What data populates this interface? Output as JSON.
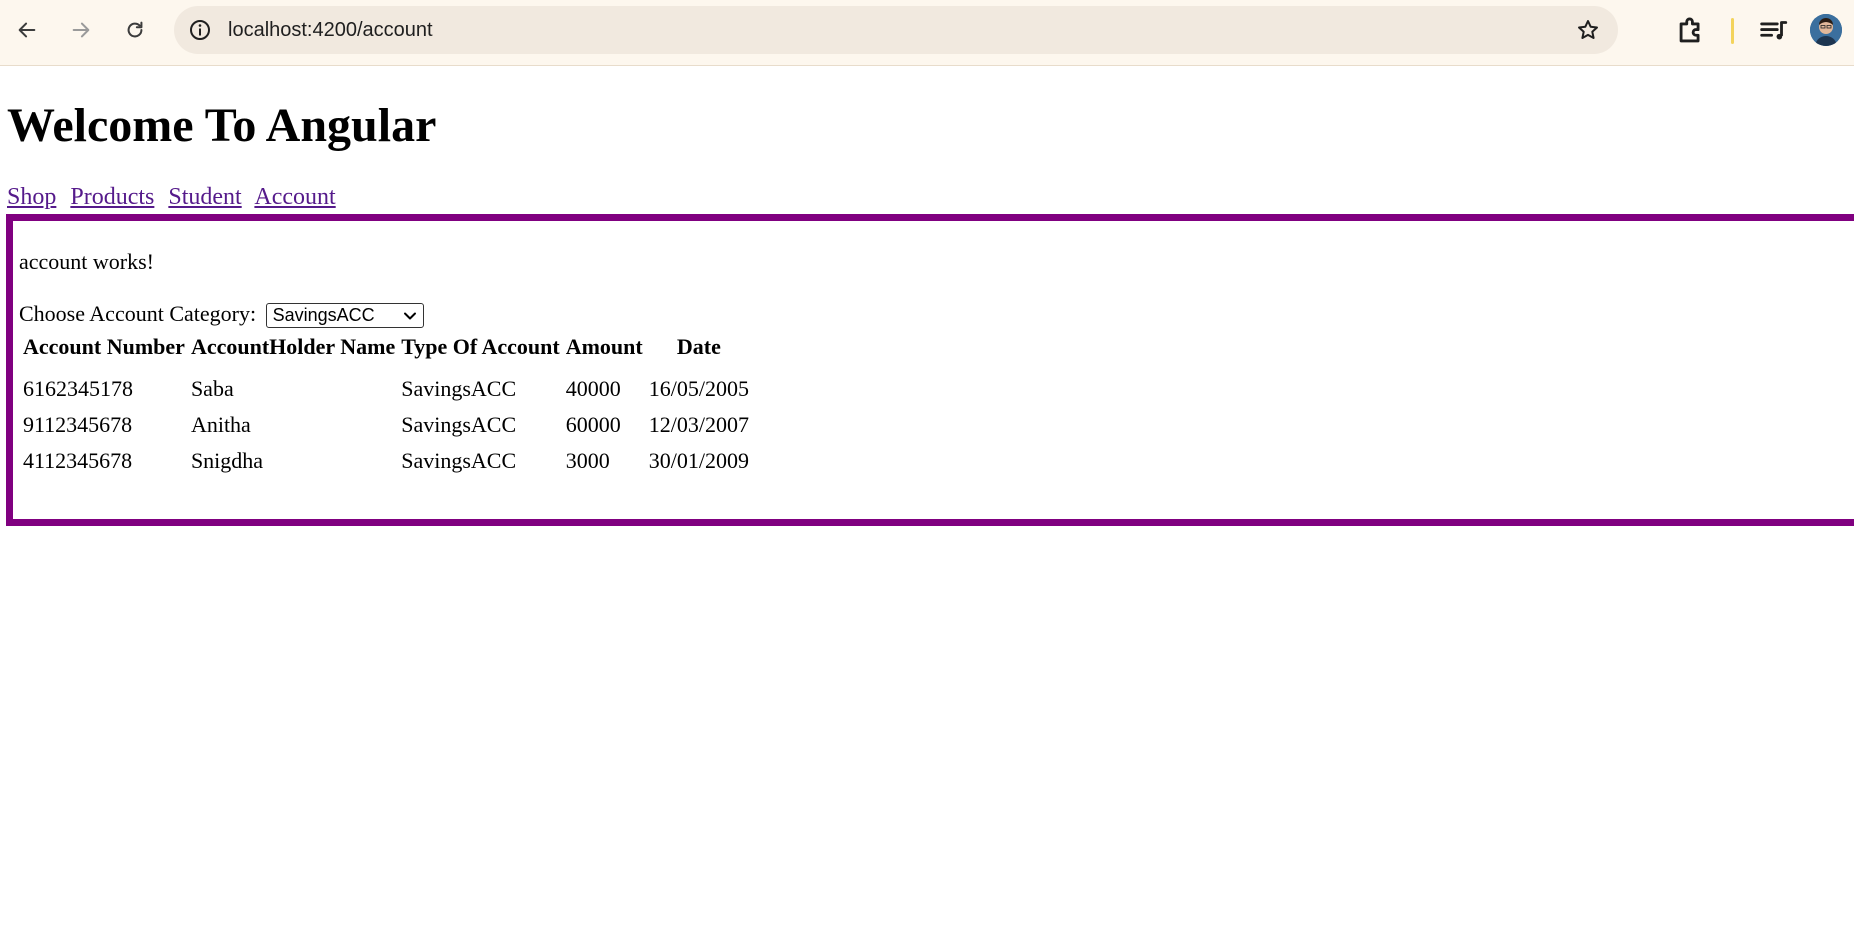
{
  "browser": {
    "url": "localhost:4200/account"
  },
  "page": {
    "title": "Welcome To Angular",
    "nav_links": [
      "Shop",
      "Products",
      "Student",
      "Account"
    ],
    "status_text": "account works!",
    "category_label": "Choose Account Category:",
    "category_selected": "SavingsACC",
    "table": {
      "headers": [
        "Account Number",
        "AccountHolder Name",
        "Type Of Account",
        "Amount",
        "Date"
      ],
      "rows": [
        [
          "6162345178",
          "Saba",
          "SavingsACC",
          "40000",
          "16/05/2005"
        ],
        [
          "9112345678",
          "Anitha",
          "SavingsACC",
          "60000",
          "12/03/2007"
        ],
        [
          "4112345678",
          "Snigdha",
          "SavingsACC",
          "3000",
          "30/01/2009"
        ]
      ]
    }
  },
  "colors": {
    "frame_border": "#800080",
    "visited_link": "#551a8b",
    "chrome_bg": "#fdf7ee",
    "omnibox_bg": "#f1e9df"
  }
}
